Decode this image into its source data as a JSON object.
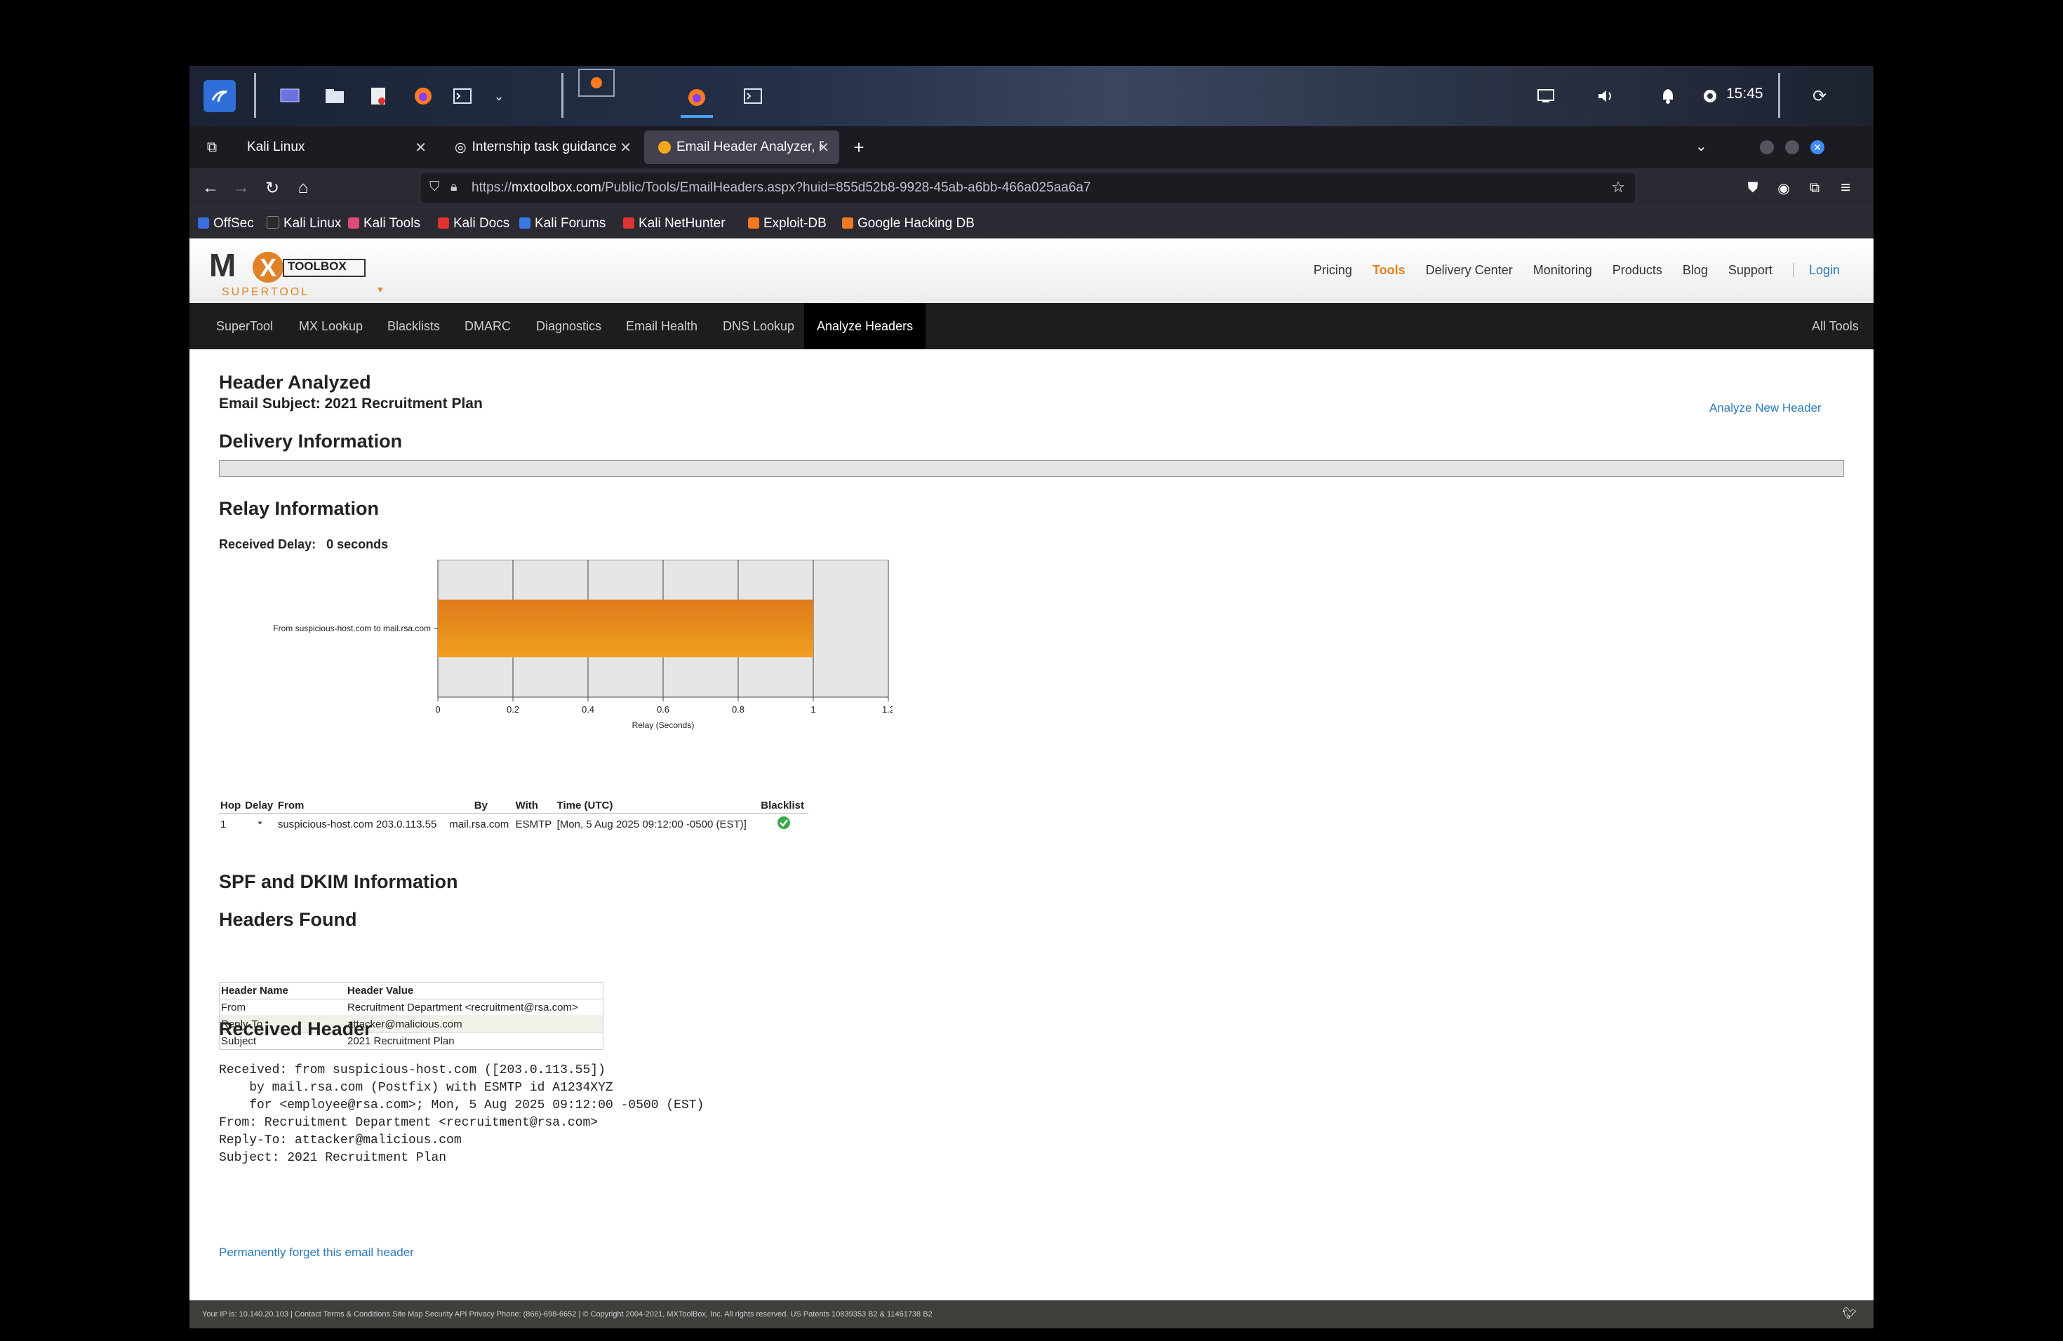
{
  "taskbar": {
    "clock": "15:45",
    "icons": [
      "kali-menu-icon",
      "desktop-icon",
      "files-icon",
      "text-editor-icon",
      "firefox-icon",
      "terminal-icon",
      "chevron-down-icon",
      "firefox-window-icon",
      "firefox-active-icon",
      "terminal-window-icon",
      "display-icon",
      "volume-icon",
      "bell-icon",
      "power-status-icon",
      "logout-icon"
    ]
  },
  "browser": {
    "tabs": [
      {
        "label": "Kali Linux"
      },
      {
        "label": "Internship task guidance"
      },
      {
        "label": "Email Header Analyzer, R"
      }
    ],
    "url_prefix": "https://",
    "url_domain": "mxtoolbox.com",
    "url_path": "/Public/Tools/EmailHeaders.aspx?huid=855d52b8-9928-45ab-a6bb-466a025aa6a7",
    "bookmarks": [
      "OffSec",
      "Kali Linux",
      "Kali Tools",
      "Kali Docs",
      "Kali Forums",
      "Kali NetHunter",
      "Exploit-DB",
      "Google Hacking DB"
    ]
  },
  "site": {
    "logo_text": "TOOLBOX",
    "logo_sub": "SUPERTOOL",
    "top_nav": [
      "Pricing",
      "Tools",
      "Delivery Center",
      "Monitoring",
      "Products",
      "Blog",
      "Support"
    ],
    "login": "Login",
    "tool_nav": [
      "SuperTool",
      "MX Lookup",
      "Blacklists",
      "DMARC",
      "Diagnostics",
      "Email Health",
      "DNS Lookup",
      "Analyze Headers"
    ],
    "all_tools": "All Tools",
    "accent": "#e08226",
    "link_color": "#2a7ab8"
  },
  "report": {
    "title": "Header Analyzed",
    "subject_line": "Email Subject: 2021 Recruitment Plan",
    "analyze_new": "Analyze New Header",
    "delivery_title": "Delivery Information",
    "relay_title": "Relay Information",
    "received_delay_label": "Received Delay:",
    "received_delay_value": "0 seconds",
    "relay_columns": [
      "Hop",
      "Delay",
      "From",
      "By",
      "With",
      "Time (UTC)",
      "Blacklist"
    ],
    "relay_rows": [
      {
        "hop": "1",
        "delay": "*",
        "from": "suspicious-host.com 203.0.113.55",
        "by": "mail.rsa.com",
        "with": "ESMTP",
        "time": "[Mon, 5 Aug 2025 09:12:00 -0500 (EST)]"
      }
    ],
    "spf_title": "SPF and DKIM Information",
    "headers_title": "Headers Found",
    "header_columns": [
      "Header Name",
      "Header Value"
    ],
    "header_rows": [
      {
        "name": "From",
        "value": "Recruitment Department <recruitment@rsa.com>"
      },
      {
        "name": "Reply-To",
        "value": "attacker@malicious.com"
      },
      {
        "name": "Subject",
        "value": "2021 Recruitment Plan"
      }
    ],
    "received_title": "Received Header",
    "raw_header": "Received: from suspicious-host.com ([203.0.113.55])\n    by mail.rsa.com (Postfix) with ESMTP id A1234XYZ\n    for <employee@rsa.com>; Mon, 5 Aug 2025 09:12:00 -0500 (EST)\nFrom: Recruitment Department <recruitment@rsa.com>\nReply-To: attacker@malicious.com\nSubject: 2021 Recruitment Plan",
    "forget_link": "Permanently forget this email header"
  },
  "chart_data": {
    "type": "bar",
    "orientation": "horizontal",
    "categories": [
      "From suspicious-host.com to mail.rsa.com"
    ],
    "values": [
      1
    ],
    "xlabel": "Relay (Seconds)",
    "xlim": [
      0,
      1.2
    ],
    "xticks": [
      "0",
      "0.2",
      "0.4",
      "0.6",
      "0.8",
      "1",
      "1.2"
    ],
    "grid": true,
    "bar_color": "#f0a020"
  },
  "footer": {
    "text": "Your IP is: 10.140.20.103 | Contact Terms & Conditions Site Map Security API Privacy Phone: (866)-698-6652 | © Copyright 2004-2021, MXToolBox, Inc. All rights reserved. US Patents 10839353 B2 & 11461738 B2"
  }
}
